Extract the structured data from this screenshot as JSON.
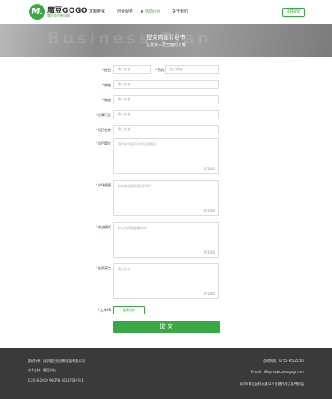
{
  "header": {
    "logo_glyph": "M.",
    "brand": "魔豆GOGO",
    "brand_sub": "魔豆商业孵化器",
    "nav": [
      {
        "label": "定制孵化",
        "active": false
      },
      {
        "label": "创业服务",
        "active": false
      },
      {
        "label": "活动行业",
        "active": true
      },
      {
        "label": "关于我们",
        "active": false
      }
    ],
    "submit_bp": "BP提交"
  },
  "banner": {
    "bg_text": "Business Plan",
    "title": "提交商业计划书",
    "subtitle": "让投资人更全面的了解"
  },
  "form": {
    "name": {
      "label": "姓名",
      "placeholder": "输入姓名"
    },
    "phone": {
      "label": "手机",
      "placeholder": "输入姓名"
    },
    "email": {
      "label": "邮箱",
      "placeholder": "输入姓名"
    },
    "wechat": {
      "label": "微信",
      "placeholder": "输入姓名"
    },
    "industry": {
      "label": "所属行业",
      "placeholder": "输入姓名"
    },
    "project_name": {
      "label": "项目名称",
      "placeholder": "输入姓名"
    },
    "intro": {
      "label": "项目简介",
      "placeholder": "请简单介绍下你的项目概况？",
      "counter": "0/1000"
    },
    "market": {
      "label": "市场规模",
      "placeholder": "你的商业模式是怎样的？",
      "counter": "0/1000"
    },
    "business_model": {
      "label": "商业模式",
      "placeholder": "你认为你能够赚钱吗？",
      "counter": "0/1000"
    },
    "investment": {
      "label": "投资亮点",
      "placeholder": "输入姓名",
      "counter": "0/1000"
    },
    "upload": {
      "label": "上传BP",
      "button": "选择文件"
    },
    "submit": "提 交"
  },
  "footer": {
    "copyright_owner": "版权所有：深圳魔豆创业孵化器有限公司",
    "tech_support": "技术支持：魔豆科技",
    "icp": "©2016-2018    粤ICP备 16117084号-1",
    "hotline": "咨询热线：0755-86525500",
    "email": "E-mail：83@magicbeangogo.com",
    "address": "深圳市南山区科苑路11号金融科技大厦A座4层"
  },
  "colors": {
    "accent": "#3aa845",
    "footer_bg": "#3a3a3a"
  }
}
